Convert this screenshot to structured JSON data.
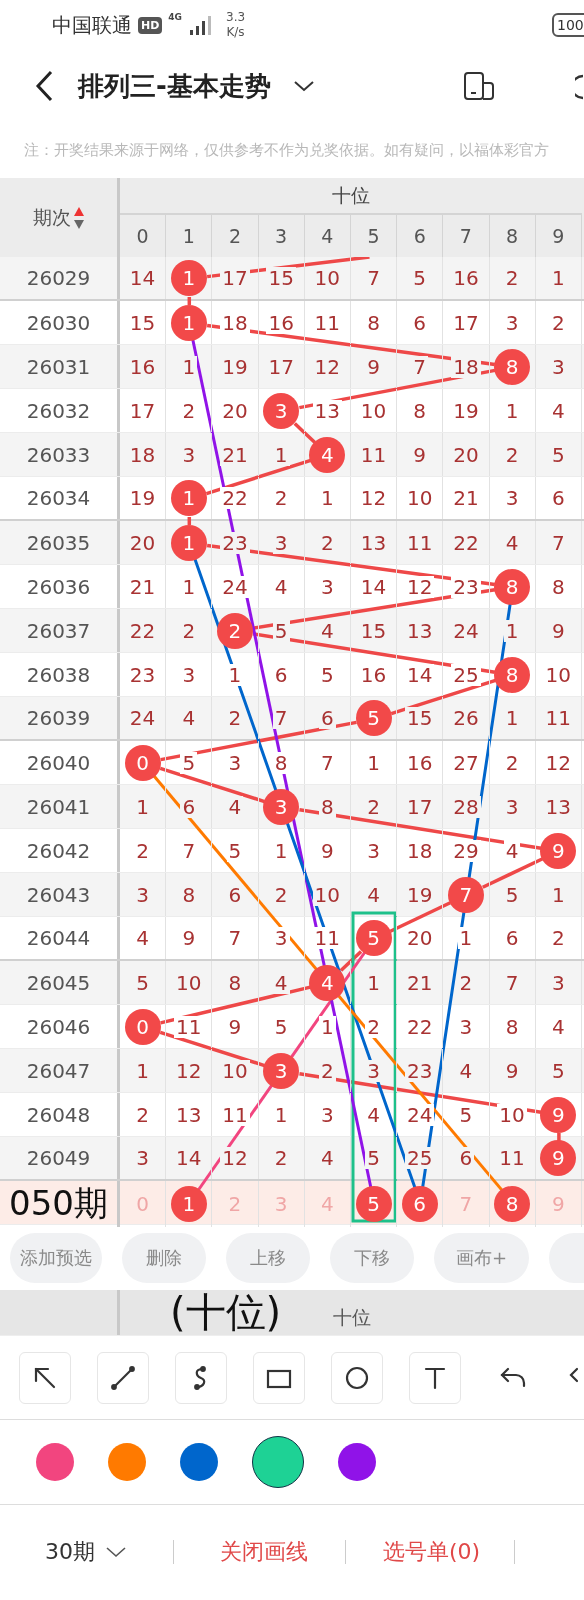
{
  "status_bar": {
    "carrier": "中国联通",
    "hd_badge": "HD",
    "network": "4G",
    "speed": "3.3",
    "speed_unit": "K/s",
    "battery": "100"
  },
  "title_bar": {
    "title": "排列三-基本走势"
  },
  "notice": "注：开奖结果来源于网络，仅供参考不作为兑奖依据。如有疑问，以福体彩官方",
  "table": {
    "period_header": "期次",
    "group_header": "十位",
    "digits": [
      "0",
      "1",
      "2",
      "3",
      "4",
      "5",
      "6",
      "7",
      "8",
      "9"
    ],
    "rows": [
      {
        "kind": "draw",
        "period": "26029",
        "cells": [
          "14",
          "1",
          "17",
          "15",
          "10",
          "7",
          "5",
          "16",
          "2",
          "1"
        ],
        "hits": [
          false,
          true,
          false,
          false,
          false,
          false,
          false,
          false,
          false,
          false
        ]
      },
      {
        "kind": "draw",
        "period": "26030",
        "cells": [
          "15",
          "1",
          "18",
          "16",
          "11",
          "8",
          "6",
          "17",
          "3",
          "2"
        ],
        "hits": [
          false,
          true,
          false,
          false,
          false,
          false,
          false,
          false,
          false,
          false
        ]
      },
      {
        "kind": "draw",
        "period": "26031",
        "cells": [
          "16",
          "1",
          "19",
          "17",
          "12",
          "9",
          "7",
          "18",
          "8",
          "3"
        ],
        "hits": [
          false,
          false,
          false,
          false,
          false,
          false,
          false,
          false,
          true,
          false
        ]
      },
      {
        "kind": "draw",
        "period": "26032",
        "cells": [
          "17",
          "2",
          "20",
          "3",
          "13",
          "10",
          "8",
          "19",
          "1",
          "4"
        ],
        "hits": [
          false,
          false,
          false,
          true,
          false,
          false,
          false,
          false,
          false,
          false
        ]
      },
      {
        "kind": "draw",
        "period": "26033",
        "cells": [
          "18",
          "3",
          "21",
          "1",
          "4",
          "11",
          "9",
          "20",
          "2",
          "5"
        ],
        "hits": [
          false,
          false,
          false,
          false,
          true,
          false,
          false,
          false,
          false,
          false
        ]
      },
      {
        "kind": "draw",
        "period": "26034",
        "cells": [
          "19",
          "1",
          "22",
          "2",
          "1",
          "12",
          "10",
          "21",
          "3",
          "6"
        ],
        "hits": [
          false,
          true,
          false,
          false,
          false,
          false,
          false,
          false,
          false,
          false
        ]
      },
      {
        "kind": "draw",
        "period": "26035",
        "cells": [
          "20",
          "1",
          "23",
          "3",
          "2",
          "13",
          "11",
          "22",
          "4",
          "7"
        ],
        "hits": [
          false,
          true,
          false,
          false,
          false,
          false,
          false,
          false,
          false,
          false
        ]
      },
      {
        "kind": "draw",
        "period": "26036",
        "cells": [
          "21",
          "1",
          "24",
          "4",
          "3",
          "14",
          "12",
          "23",
          "8",
          "8"
        ],
        "hits": [
          false,
          false,
          false,
          false,
          false,
          false,
          false,
          false,
          true,
          false
        ]
      },
      {
        "kind": "draw",
        "period": "26037",
        "cells": [
          "22",
          "2",
          "2",
          "5",
          "4",
          "15",
          "13",
          "24",
          "1",
          "9"
        ],
        "hits": [
          false,
          false,
          true,
          false,
          false,
          false,
          false,
          false,
          false,
          false
        ]
      },
      {
        "kind": "draw",
        "period": "26038",
        "cells": [
          "23",
          "3",
          "1",
          "6",
          "5",
          "16",
          "14",
          "25",
          "8",
          "10"
        ],
        "hits": [
          false,
          false,
          false,
          false,
          false,
          false,
          false,
          false,
          true,
          false
        ]
      },
      {
        "kind": "draw",
        "period": "26039",
        "cells": [
          "24",
          "4",
          "2",
          "7",
          "6",
          "5",
          "15",
          "26",
          "1",
          "11"
        ],
        "hits": [
          false,
          false,
          false,
          false,
          false,
          true,
          false,
          false,
          false,
          false
        ]
      },
      {
        "kind": "draw",
        "period": "26040",
        "cells": [
          "0",
          "5",
          "3",
          "8",
          "7",
          "1",
          "16",
          "27",
          "2",
          "12"
        ],
        "hits": [
          true,
          false,
          false,
          false,
          false,
          false,
          false,
          false,
          false,
          false
        ]
      },
      {
        "kind": "draw",
        "period": "26041",
        "cells": [
          "1",
          "6",
          "4",
          "3",
          "8",
          "2",
          "17",
          "28",
          "3",
          "13"
        ],
        "hits": [
          false,
          false,
          false,
          true,
          false,
          false,
          false,
          false,
          false,
          false
        ]
      },
      {
        "kind": "draw",
        "period": "26042",
        "cells": [
          "2",
          "7",
          "5",
          "1",
          "9",
          "3",
          "18",
          "29",
          "4",
          "9"
        ],
        "hits": [
          false,
          false,
          false,
          false,
          false,
          false,
          false,
          false,
          false,
          true
        ]
      },
      {
        "kind": "draw",
        "period": "26043",
        "cells": [
          "3",
          "8",
          "6",
          "2",
          "10",
          "4",
          "19",
          "7",
          "5",
          "1"
        ],
        "hits": [
          false,
          false,
          false,
          false,
          false,
          false,
          false,
          true,
          false,
          false
        ]
      },
      {
        "kind": "draw",
        "period": "26044",
        "cells": [
          "4",
          "9",
          "7",
          "3",
          "11",
          "5",
          "20",
          "1",
          "6",
          "2"
        ],
        "hits": [
          false,
          false,
          false,
          false,
          false,
          true,
          false,
          false,
          false,
          false
        ]
      },
      {
        "kind": "draw",
        "period": "26045",
        "cells": [
          "5",
          "10",
          "8",
          "4",
          "4",
          "1",
          "21",
          "2",
          "7",
          "3"
        ],
        "hits": [
          false,
          false,
          false,
          false,
          true,
          false,
          false,
          false,
          false,
          false
        ]
      },
      {
        "kind": "draw",
        "period": "26046",
        "cells": [
          "0",
          "11",
          "9",
          "5",
          "1",
          "2",
          "22",
          "3",
          "8",
          "4"
        ],
        "hits": [
          true,
          false,
          false,
          false,
          false,
          false,
          false,
          false,
          false,
          false
        ]
      },
      {
        "kind": "draw",
        "period": "26047",
        "cells": [
          "1",
          "12",
          "10",
          "3",
          "2",
          "3",
          "23",
          "4",
          "9",
          "5"
        ],
        "hits": [
          false,
          false,
          false,
          true,
          false,
          false,
          false,
          false,
          false,
          false
        ]
      },
      {
        "kind": "draw",
        "period": "26048",
        "cells": [
          "2",
          "13",
          "11",
          "1",
          "3",
          "4",
          "24",
          "5",
          "10",
          "9"
        ],
        "hits": [
          false,
          false,
          false,
          false,
          false,
          false,
          false,
          false,
          false,
          true
        ]
      },
      {
        "kind": "draw",
        "period": "26049",
        "cells": [
          "3",
          "14",
          "12",
          "2",
          "4",
          "5",
          "25",
          "6",
          "11",
          "9"
        ],
        "hits": [
          false,
          false,
          false,
          false,
          false,
          false,
          false,
          false,
          false,
          true
        ]
      },
      {
        "kind": "selection",
        "period": "050期",
        "cells": [
          "0",
          "1",
          "2",
          "3",
          "4",
          "5",
          "6",
          "7",
          "8",
          "9"
        ],
        "hits": [
          false,
          true,
          false,
          false,
          false,
          true,
          true,
          false,
          true,
          false
        ]
      }
    ],
    "footer_header": "十位"
  },
  "overlay_caption": "(十位)",
  "actions": [
    "添加预选",
    "删除",
    "上移",
    "下移",
    "画布+"
  ],
  "palette": [
    {
      "color": "#f2457f",
      "selected": false
    },
    {
      "color": "#ff7a00",
      "selected": false
    },
    {
      "color": "#0066cc",
      "selected": false
    },
    {
      "color": "#1ed295",
      "selected": true
    },
    {
      "color": "#9013e8",
      "selected": false
    }
  ],
  "bottom_bar": {
    "period_select": "30期",
    "close_drawing": "关闭画线",
    "pick_list": "选号单(0)"
  }
}
